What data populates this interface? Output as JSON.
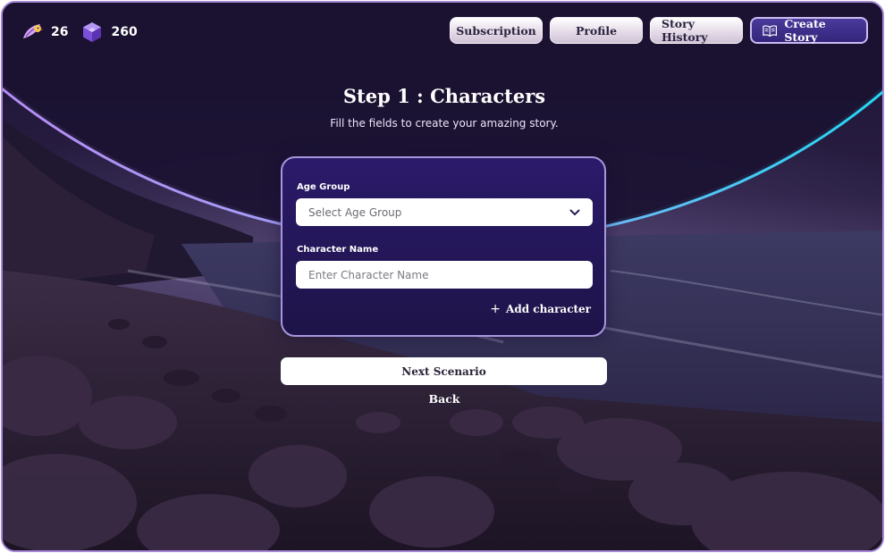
{
  "stats": {
    "feathers": {
      "value": "26",
      "icon": "bird-feather-icon"
    },
    "gems": {
      "value": "260",
      "icon": "purple-gem-icon"
    }
  },
  "nav": {
    "subscription": "Subscription",
    "profile": "Profile",
    "story_history": "Story History",
    "create_story": "Create Story",
    "create_story_icon": "open-book-icon"
  },
  "page": {
    "title": "Step 1 : Characters",
    "subtitle": "Fill the fields to create your amazing story."
  },
  "form": {
    "age_group_label": "Age Group",
    "age_group_value": "Select Age Group",
    "character_name_label": "Character Name",
    "character_name_placeholder": "Enter Character Name",
    "add_character": "Add character"
  },
  "actions": {
    "next": "Next Scenario",
    "back": "Back"
  },
  "colors": {
    "accent_arc_left": "#b58cf4",
    "accent_arc_right": "#22d8f2",
    "card_bg": "#251760",
    "card_border": "#a995dd",
    "frame_border": "#a889d6"
  }
}
